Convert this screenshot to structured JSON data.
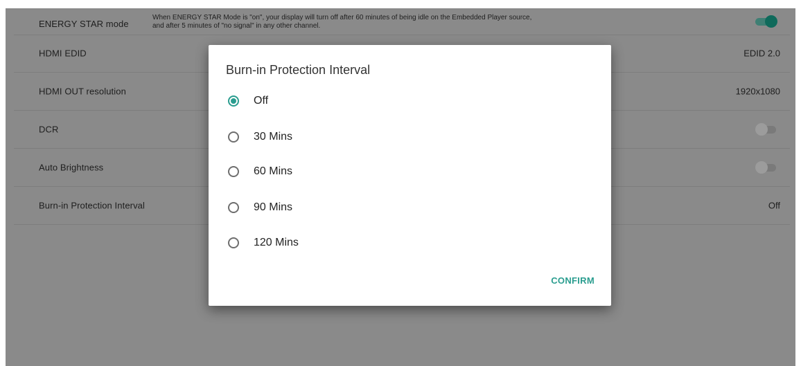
{
  "settings": {
    "rows": [
      {
        "label": "ENERGY STAR mode",
        "description_line1": "When ENERGY STAR Mode is \"on\", your display will turn off after 60 minutes of being idle on the Embedded Player source,",
        "description_line2": "and after 5 minutes of \"no signal\" in any other channel.",
        "toggle": "on"
      },
      {
        "label": "HDMI EDID",
        "value": "EDID 2.0"
      },
      {
        "label": "HDMI OUT resolution",
        "value": "1920x1080"
      },
      {
        "label": "DCR",
        "toggle": "off"
      },
      {
        "label": "Auto Brightness",
        "toggle": "off"
      },
      {
        "label": "Burn-in Protection Interval",
        "value": "Off"
      }
    ]
  },
  "dialog": {
    "title": "Burn-in Protection Interval",
    "options": [
      {
        "label": "Off",
        "selected": true
      },
      {
        "label": "30 Mins",
        "selected": false
      },
      {
        "label": "60 Mins",
        "selected": false
      },
      {
        "label": "90 Mins",
        "selected": false
      },
      {
        "label": "120 Mins",
        "selected": false
      }
    ],
    "confirm_label": "CONFIRM"
  },
  "colors": {
    "accent": "#2a9d8f",
    "toggle_on": "#0f6a5b",
    "dim_background": "#8a8a8a"
  },
  "icons": [
    "radio-checked-icon",
    "radio-unchecked-icon",
    "toggle-on-icon",
    "toggle-off-icon"
  ]
}
